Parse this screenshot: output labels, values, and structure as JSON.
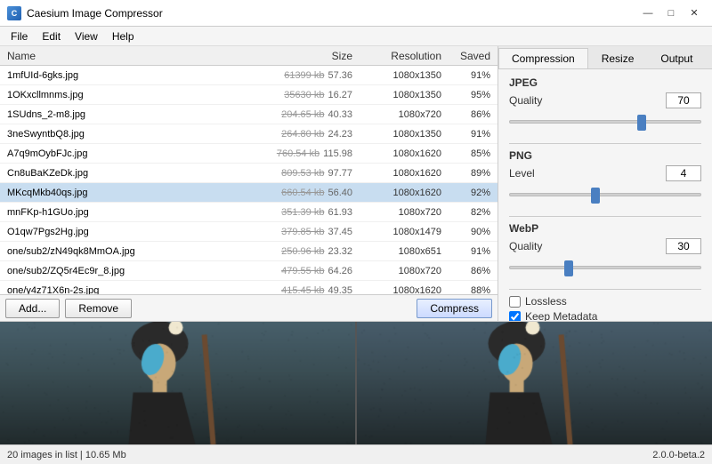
{
  "window": {
    "title": "Caesium Image Compressor",
    "controls": [
      "minimize",
      "maximize",
      "close"
    ]
  },
  "menu": {
    "items": [
      "File",
      "Edit",
      "View",
      "Help"
    ]
  },
  "file_table": {
    "headers": [
      "Name",
      "Size",
      "Resolution",
      "Saved"
    ],
    "rows": [
      {
        "name": "1mfUId-6gks.jpg",
        "original_size": "61399 kb",
        "new_size": "57.36",
        "resolution": "1080x1350",
        "saved": "91%"
      },
      {
        "name": "1OKxcllmnms.jpg",
        "original_size": "35630 kb",
        "new_size": "16.27",
        "resolution": "1080x1350",
        "saved": "95%"
      },
      {
        "name": "1SUdns_2-m8.jpg",
        "original_size": "204.65 kb",
        "new_size": "40.33",
        "resolution": "1080x720",
        "saved": "86%"
      },
      {
        "name": "3neSwyntbQ8.jpg",
        "original_size": "264.80 kb",
        "new_size": "24.23",
        "resolution": "1080x1350",
        "saved": "91%"
      },
      {
        "name": "A7q9mOybFJc.jpg",
        "original_size": "760.54 kb",
        "new_size": "115.98",
        "resolution": "1080x1620",
        "saved": "85%"
      },
      {
        "name": "Cn8uBaKZeDk.jpg",
        "original_size": "809.53 kb",
        "new_size": "97.77",
        "resolution": "1080x1620",
        "saved": "89%"
      },
      {
        "name": "MKcqMkb40qs.jpg",
        "original_size": "660.54 kb",
        "new_size": "56.40",
        "resolution": "1080x1620",
        "saved": "92%",
        "selected": true
      },
      {
        "name": "mnFKp-h1GUo.jpg",
        "original_size": "351.39 kb",
        "new_size": "61.93",
        "resolution": "1080x720",
        "saved": "82%"
      },
      {
        "name": "O1qw7Pgs2Hg.jpg",
        "original_size": "379.85 kb",
        "new_size": "37.45",
        "resolution": "1080x1479",
        "saved": "90%"
      },
      {
        "name": "one/sub2/zN49qk8MmOA.jpg",
        "original_size": "250.96 kb",
        "new_size": "23.32",
        "resolution": "1080x651",
        "saved": "91%"
      },
      {
        "name": "one/sub2/ZQ5r4Ec9r_8.jpg",
        "original_size": "479.55 kb",
        "new_size": "64.26",
        "resolution": "1080x720",
        "saved": "86%"
      },
      {
        "name": "one/y4z71X6n-2s.jpg",
        "original_size": "415.45 kb",
        "new_size": "49.35",
        "resolution": "1080x1620",
        "saved": "88%"
      }
    ]
  },
  "toolbar": {
    "add_label": "Add...",
    "remove_label": "Remove",
    "compress_label": "Compress"
  },
  "right_panel": {
    "tabs": [
      "Compression",
      "Resize",
      "Output"
    ],
    "active_tab": "Compression",
    "jpeg": {
      "label": "JPEG",
      "quality_label": "Quality",
      "quality_value": "70",
      "slider_percent": 70
    },
    "png": {
      "label": "PNG",
      "level_label": "Level",
      "level_value": "4",
      "slider_percent": 40
    },
    "webp": {
      "label": "WebP",
      "quality_label": "Quality",
      "quality_value": "30",
      "slider_percent": 30
    },
    "lossless_label": "Lossless",
    "lossless_checked": false,
    "keep_metadata_label": "Keep Metadata",
    "keep_metadata_checked": true
  },
  "status_bar": {
    "left": "20 images in list | 10.65 Mb",
    "right": "2.0.0-beta.2"
  }
}
